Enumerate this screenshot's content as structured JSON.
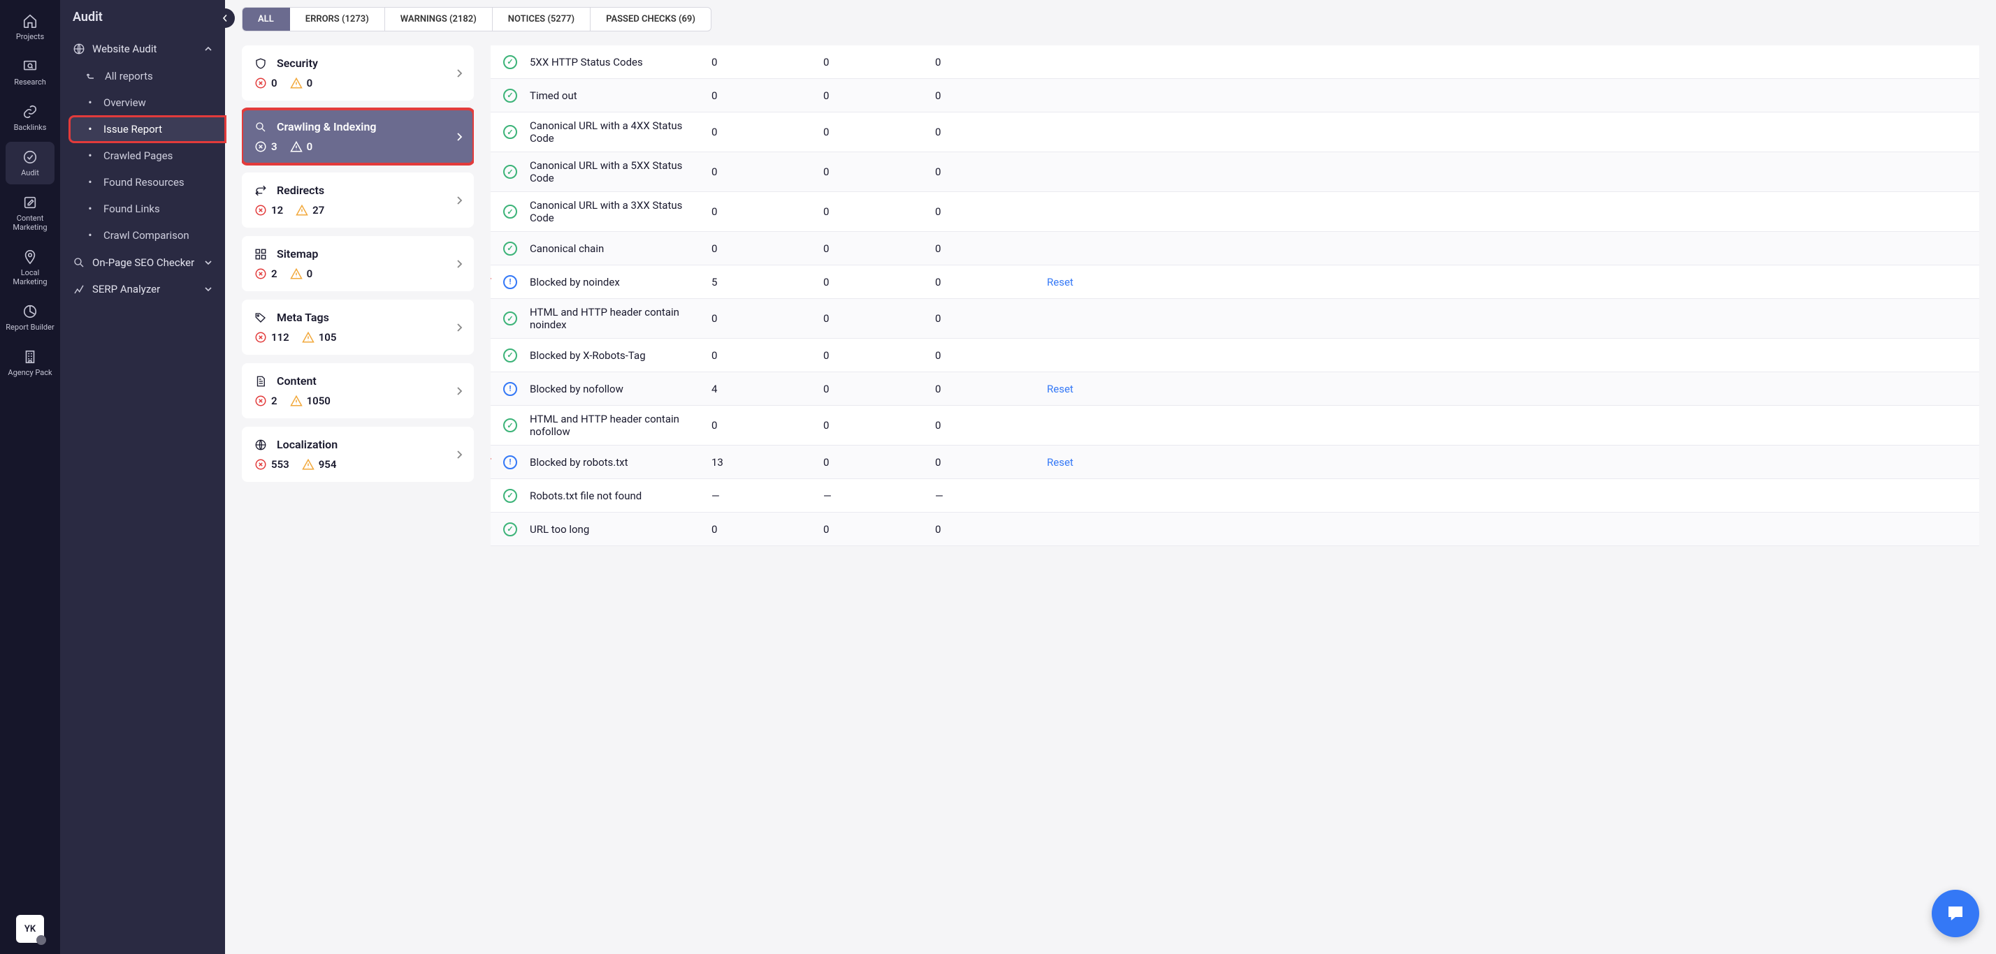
{
  "rail": {
    "items": [
      {
        "label": "Projects",
        "icon": "home"
      },
      {
        "label": "Research",
        "icon": "monitor"
      },
      {
        "label": "Backlinks",
        "icon": "link"
      },
      {
        "label": "Audit",
        "icon": "check-circle",
        "active": true
      },
      {
        "label": "Content Marketing",
        "icon": "edit"
      },
      {
        "label": "Local Marketing",
        "icon": "pin"
      },
      {
        "label": "Report Builder",
        "icon": "pie"
      },
      {
        "label": "Agency Pack",
        "icon": "building"
      }
    ],
    "avatar": "YK"
  },
  "nav": {
    "title": "Audit",
    "section": {
      "label": "Website Audit",
      "icon": "globe"
    },
    "items": [
      {
        "label": "All reports",
        "icon": "back"
      },
      {
        "label": "Overview"
      },
      {
        "label": "Issue Report",
        "active": true,
        "highlight": true
      },
      {
        "label": "Crawled Pages"
      },
      {
        "label": "Found Resources"
      },
      {
        "label": "Found Links"
      },
      {
        "label": "Crawl Comparison"
      }
    ],
    "extra": [
      {
        "label": "On-Page SEO Checker",
        "icon": "search"
      },
      {
        "label": "SERP Analyzer",
        "icon": "chart"
      }
    ]
  },
  "tabs": [
    {
      "label": "ALL",
      "active": true
    },
    {
      "label": "ERRORS (1273)"
    },
    {
      "label": "WARNINGS (2182)"
    },
    {
      "label": "NOTICES (5277)"
    },
    {
      "label": "PASSED CHECKS (69)"
    }
  ],
  "categories": [
    {
      "name": "Security",
      "icon": "shield",
      "errors": "0",
      "warnings": "0"
    },
    {
      "name": "Crawling & Indexing",
      "icon": "search",
      "errors": "3",
      "warnings": "0",
      "active": true,
      "highlight": true
    },
    {
      "name": "Redirects",
      "icon": "redirect",
      "errors": "12",
      "warnings": "27"
    },
    {
      "name": "Sitemap",
      "icon": "grid",
      "errors": "2",
      "warnings": "0"
    },
    {
      "name": "Meta Tags",
      "icon": "tag",
      "errors": "112",
      "warnings": "105"
    },
    {
      "name": "Content",
      "icon": "doc",
      "errors": "2",
      "warnings": "1050"
    },
    {
      "name": "Localization",
      "icon": "globe",
      "errors": "553",
      "warnings": "954"
    }
  ],
  "rows": [
    {
      "status": "ok",
      "name": "5XX HTTP Status Codes",
      "v1": "0",
      "v2": "0",
      "v3": "0"
    },
    {
      "status": "ok",
      "name": "Timed out",
      "v1": "0",
      "v2": "0",
      "v3": "0"
    },
    {
      "status": "ok",
      "name": "Canonical URL with a 4XX Status Code",
      "v1": "0",
      "v2": "0",
      "v3": "0"
    },
    {
      "status": "ok",
      "name": "Canonical URL with a 5XX Status Code",
      "v1": "0",
      "v2": "0",
      "v3": "0"
    },
    {
      "status": "ok",
      "name": "Canonical URL with a 3XX Status Code",
      "v1": "0",
      "v2": "0",
      "v3": "0"
    },
    {
      "status": "ok",
      "name": "Canonical chain",
      "v1": "0",
      "v2": "0",
      "v3": "0"
    },
    {
      "status": "notice",
      "name": "Blocked by noindex",
      "v1": "5",
      "v2": "0",
      "v3": "0",
      "action": "Reset",
      "arrow": true
    },
    {
      "status": "ok",
      "name": "HTML and HTTP header contain noindex",
      "v1": "0",
      "v2": "0",
      "v3": "0"
    },
    {
      "status": "ok",
      "name": "Blocked by X-Robots-Tag",
      "v1": "0",
      "v2": "0",
      "v3": "0"
    },
    {
      "status": "notice",
      "name": "Blocked by nofollow",
      "v1": "4",
      "v2": "0",
      "v3": "0",
      "action": "Reset"
    },
    {
      "status": "ok",
      "name": "HTML and HTTP header contain nofollow",
      "v1": "0",
      "v2": "0",
      "v3": "0"
    },
    {
      "status": "notice",
      "name": "Blocked by robots.txt",
      "v1": "13",
      "v2": "0",
      "v3": "0",
      "action": "Reset",
      "arrow": true
    },
    {
      "status": "ok",
      "name": "Robots.txt file not found",
      "v1": "—",
      "v2": "—",
      "v3": "—"
    },
    {
      "status": "ok",
      "name": "URL too long",
      "v1": "0",
      "v2": "0",
      "v3": "0"
    }
  ],
  "action_label": "Reset"
}
